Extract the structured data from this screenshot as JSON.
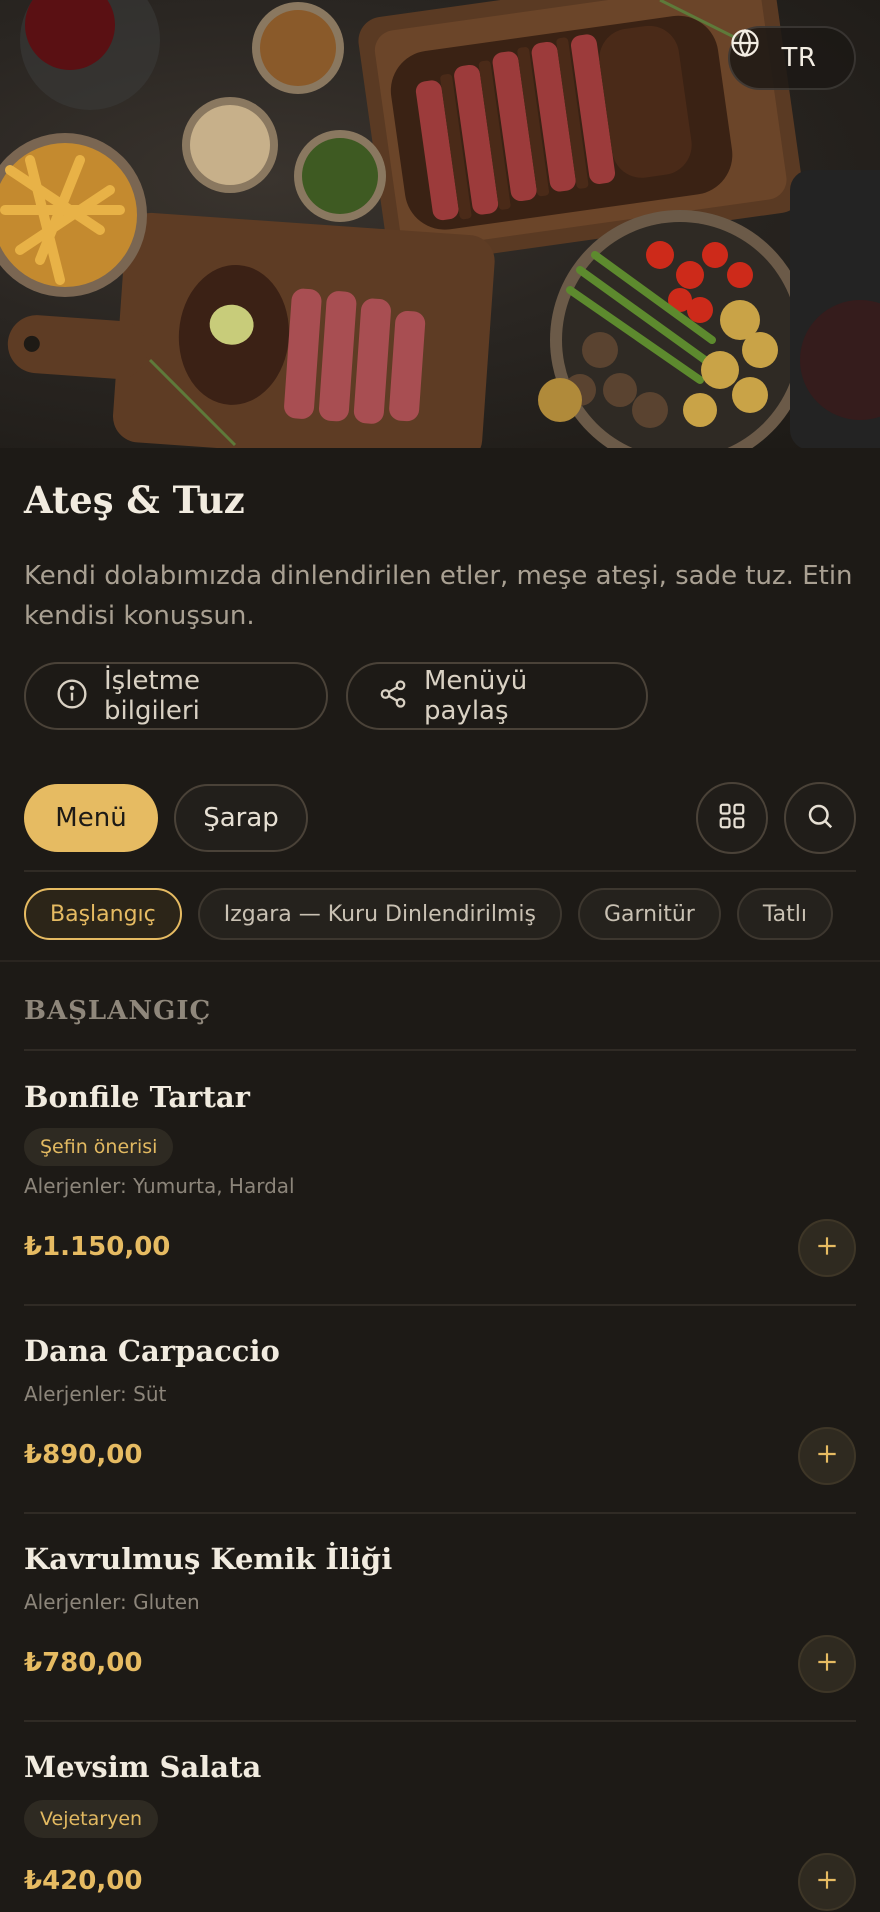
{
  "language": {
    "code": "TR"
  },
  "restaurant": {
    "name": "Ateş & Tuz",
    "tagline": "Kendi dolabımızda dinlendirilen etler, meşe ateşi, sade tuz. Etin kendisi konuşsun."
  },
  "actions": {
    "info_label": "İşletme bilgileri",
    "share_label": "Menüyü paylaş"
  },
  "tabs": [
    {
      "label": "Menü",
      "active": true
    },
    {
      "label": "Şarap",
      "active": false
    }
  ],
  "toolbar": {
    "grid_icon": "grid-icon",
    "search_icon": "search-icon"
  },
  "categories": [
    {
      "label": "Başlangıç",
      "active": true
    },
    {
      "label": "Izgara — Kuru Dinlendirilmiş",
      "active": false
    },
    {
      "label": "Garnitür",
      "active": false
    },
    {
      "label": "Tatlı",
      "active": false
    }
  ],
  "section": {
    "title": "BAŞLANGIÇ"
  },
  "items": [
    {
      "name": "Bonfile Tartar",
      "badge": "Şefin önerisi",
      "allergens": "Alerjenler: Yumurta, Hardal",
      "price": "₺1.150,00"
    },
    {
      "name": "Dana Carpaccio",
      "allergens": "Alerjenler: Süt",
      "price": "₺890,00"
    },
    {
      "name": "Kavrulmuş Kemik İliği",
      "allergens": "Alerjenler: Gluten",
      "price": "₺780,00"
    },
    {
      "name": "Mevsim Salata",
      "badge": "Vejetaryen",
      "price": "₺420,00"
    }
  ],
  "colors": {
    "accent": "#e6bb62",
    "background": "#1d1a16"
  }
}
